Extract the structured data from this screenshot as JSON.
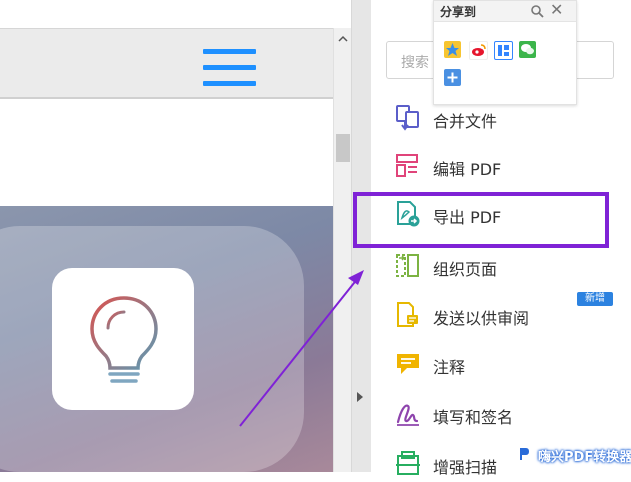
{
  "share_popup": {
    "title": "分享到",
    "icons": [
      "qzone-icon",
      "weibo-icon",
      "tieba-icon",
      "wechat-icon",
      "more-share-icon"
    ]
  },
  "search": {
    "placeholder": "搜索"
  },
  "tools": [
    {
      "label": "合并文件",
      "icon": "combine-files-icon"
    },
    {
      "label": "编辑 PDF",
      "icon": "edit-pdf-icon"
    },
    {
      "label": "导出 PDF",
      "icon": "export-pdf-icon"
    },
    {
      "label": "组织页面",
      "icon": "organize-pages-icon"
    },
    {
      "label": "发送以供审阅",
      "icon": "send-for-review-icon"
    },
    {
      "label": "注释",
      "icon": "comment-icon"
    },
    {
      "label": "填写和签名",
      "icon": "fill-sign-icon"
    },
    {
      "label": "增强扫描",
      "icon": "enhance-scan-icon"
    }
  ],
  "new_badge": "新增",
  "watermark": "嗨兴PDF转换器",
  "colors": {
    "accent_blue": "#1e90ff",
    "highlight_purple": "#7f22d6",
    "badge_blue": "#2c82e0"
  }
}
